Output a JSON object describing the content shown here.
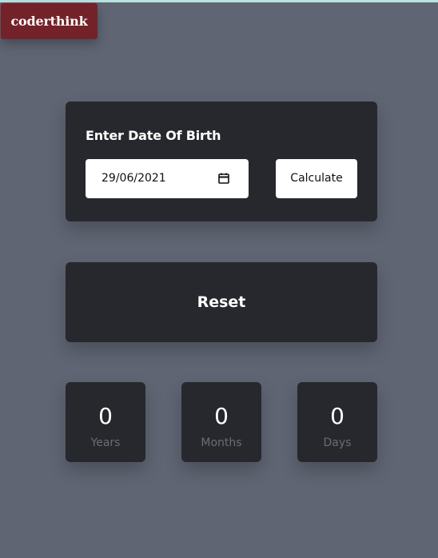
{
  "brand": {
    "name": "coderthink"
  },
  "dob_form": {
    "title": "Enter Date Of Birth",
    "date_value": "29/06/2021",
    "calculate_label": "Calculate"
  },
  "reset": {
    "label": "Reset"
  },
  "results": [
    {
      "value": "0",
      "label": "Years"
    },
    {
      "value": "0",
      "label": "Months"
    },
    {
      "value": "0",
      "label": "Days"
    }
  ],
  "icons": {
    "calendar": "calendar-icon"
  },
  "colors": {
    "page_background": "#5f6573",
    "card_background": "#27282d",
    "brand_background": "#742229",
    "top_strip": "#b9e3df",
    "button_background": "#ffffff",
    "muted_label": "#6b6d72"
  }
}
